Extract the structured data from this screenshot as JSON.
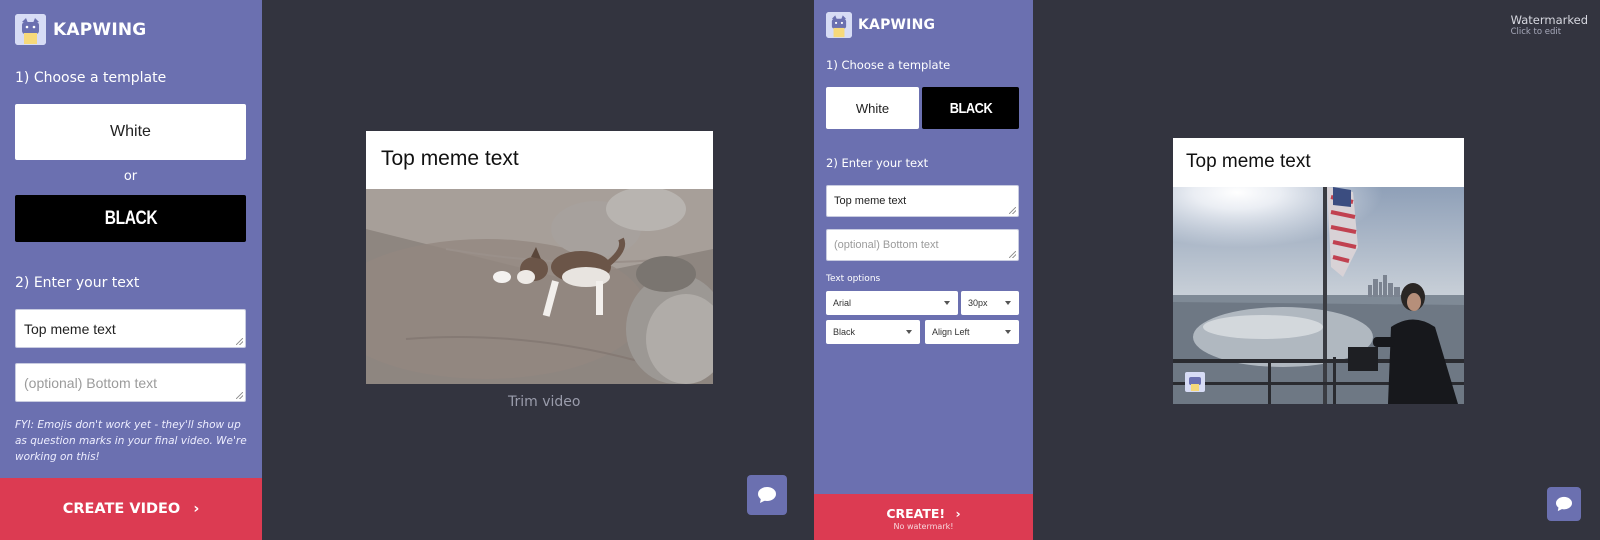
{
  "brand": {
    "name": "KAPWING"
  },
  "left_panel": {
    "step1": "1) Choose a template",
    "template_white": "White",
    "or_label": "or",
    "template_black": "BLACK",
    "step2": "2) Enter your text",
    "top_text_value": "Top meme text",
    "bottom_text_placeholder": "(optional) Bottom text",
    "fyi": "FYI: Emojis don't work yet - they'll show up as question marks in your final video. We're working on this!",
    "create_label": "CREATE VIDEO",
    "create_chevron": "›"
  },
  "left_preview": {
    "meme_text": "Top meme text",
    "trim_label": "Trim video"
  },
  "right_panel": {
    "step1": "1) Choose a template",
    "template_white": "White",
    "template_black": "BLACK",
    "step2": "2) Enter your text",
    "top_text_value": "Top meme text",
    "bottom_text_placeholder": "(optional) Bottom text",
    "text_options_label": "Text options",
    "font_select": "Arial",
    "size_select": "30px",
    "color_select": "Black",
    "align_select": "Align Left",
    "create_label": "CREATE!",
    "create_chevron": "›",
    "create_sub": "No watermark!"
  },
  "right_preview": {
    "meme_text": "Top meme text",
    "watermark_title": "Watermarked",
    "watermark_sub": "Click to edit"
  },
  "colors": {
    "sidebar": "#6b70b0",
    "canvas": "#33343f",
    "create": "#dc3b52"
  },
  "icons": {
    "logo": "kapwing-cat-logo",
    "chat": "chat-bubble-icon",
    "chevron": "chevron-right-icon"
  }
}
